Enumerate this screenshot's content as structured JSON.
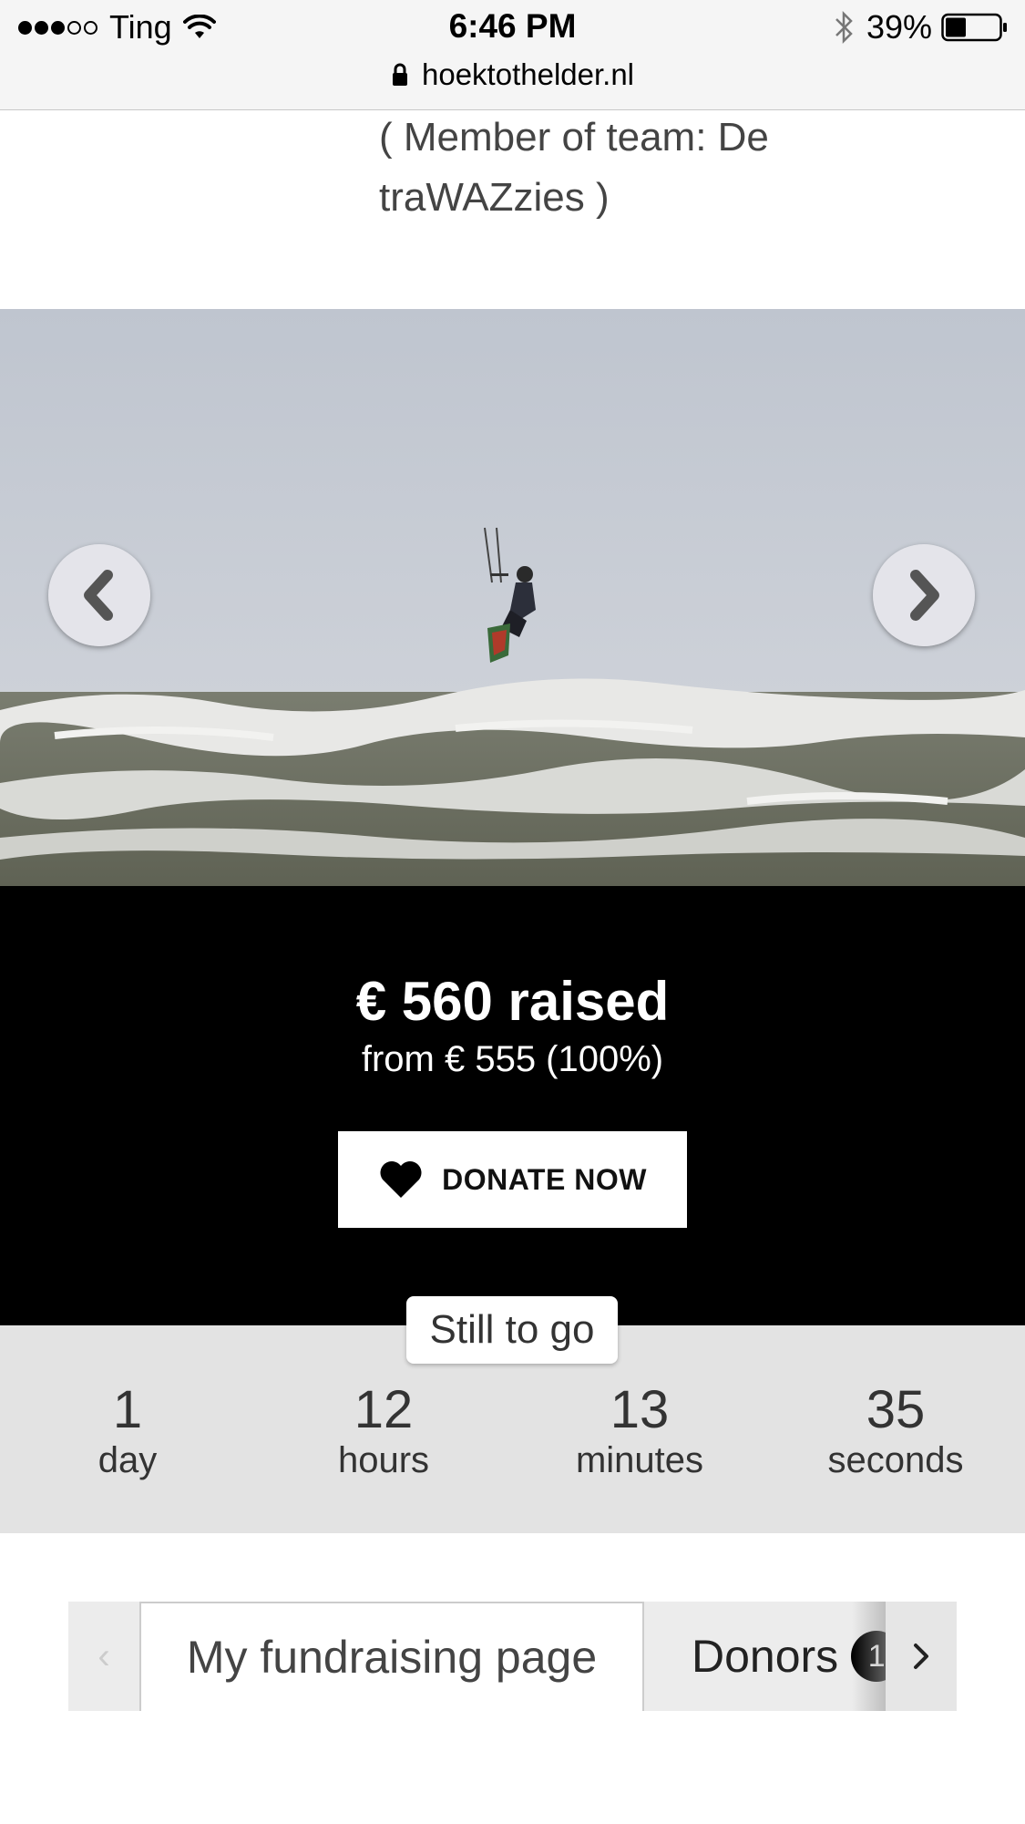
{
  "status_bar": {
    "carrier": "Ting",
    "time": "6:46 PM",
    "battery": "39%",
    "signal_bars_filled": 3,
    "signal_bars_total": 5,
    "battery_level": 0.39,
    "url": "hoektothelder.nl"
  },
  "profile": {
    "member_text": "( Member of team: De traWAZzies )"
  },
  "carousel": {
    "image_description_icon": "kitesurfer-photo",
    "prev_icon": "chevron-left-icon",
    "next_icon": "chevron-right-icon"
  },
  "fundraising": {
    "raised": "€ 560 raised",
    "goal": "from € 555 (100%)",
    "progress_fraction": 1.0,
    "donate_label": "DONATE NOW"
  },
  "countdown": {
    "label": "Still to go",
    "units": [
      {
        "value": "1",
        "label": "day"
      },
      {
        "value": "12",
        "label": "hours"
      },
      {
        "value": "13",
        "label": "minutes"
      },
      {
        "value": "35",
        "label": "seconds"
      }
    ]
  },
  "tabs": {
    "prev_glyph": "‹",
    "items": [
      {
        "label": "My fundraising page"
      },
      {
        "label": "Donors",
        "badge": "1"
      }
    ]
  },
  "colors": {
    "panel_bg": "#000000",
    "countdown_bg": "#e3e3e3",
    "status_bg": "#f5f5f5"
  }
}
